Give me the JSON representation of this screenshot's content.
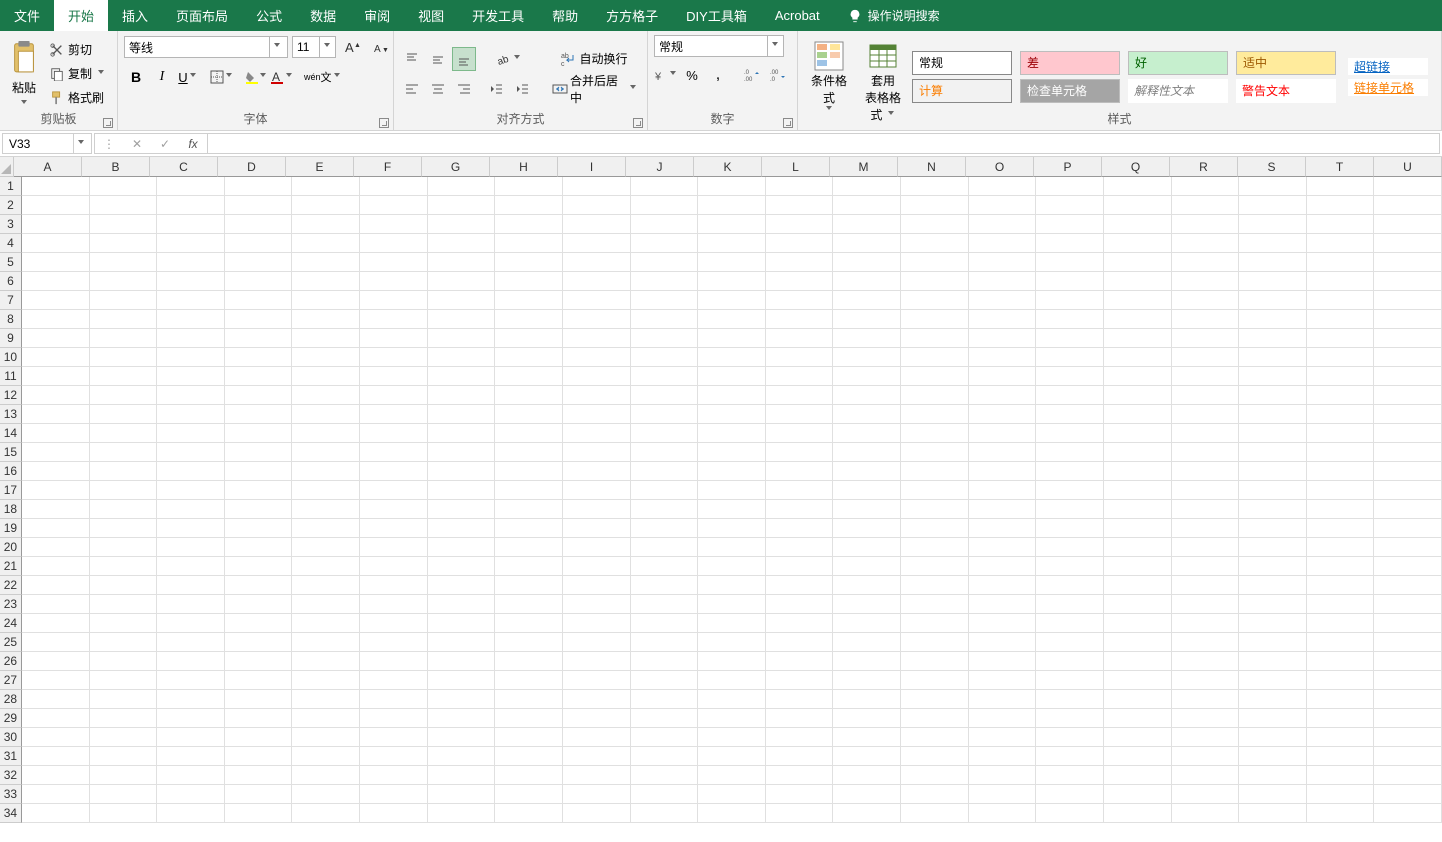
{
  "tabs": {
    "file": "文件",
    "home": "开始",
    "insert": "插入",
    "page_layout": "页面布局",
    "formulas": "公式",
    "data": "数据",
    "review": "审阅",
    "view": "视图",
    "developer": "开发工具",
    "help": "帮助",
    "fang": "方方格子",
    "diy": "DIY工具箱",
    "acrobat": "Acrobat",
    "tell_me": "操作说明搜索"
  },
  "clipboard": {
    "paste": "粘贴",
    "cut": "剪切",
    "copy": "复制",
    "format_painter": "格式刷",
    "title": "剪贴板"
  },
  "font": {
    "name": "等线",
    "size": "11",
    "phonetic": "wén",
    "title": "字体"
  },
  "alignment": {
    "wrap": "自动换行",
    "merge": "合并后居中",
    "title": "对齐方式"
  },
  "number": {
    "format": "常规",
    "title": "数字"
  },
  "cond_format": "条件格式",
  "table_format": {
    "l1": "套用",
    "l2": "表格格式"
  },
  "styles": {
    "normal": "常规",
    "bad": "差",
    "good": "好",
    "neutral": "适中",
    "calc": "计算",
    "check_cell": "检查单元格",
    "explanatory": "解释性文本",
    "warning": "警告文本",
    "hyperlink": "超链接",
    "linked_cell": "链接单元格",
    "title": "样式"
  },
  "name_box": "V33",
  "columns": [
    "A",
    "B",
    "C",
    "D",
    "E",
    "F",
    "G",
    "H",
    "I",
    "J",
    "K",
    "L",
    "M",
    "N",
    "O",
    "P",
    "Q",
    "R",
    "S",
    "T",
    "U"
  ],
  "row_count": 34
}
